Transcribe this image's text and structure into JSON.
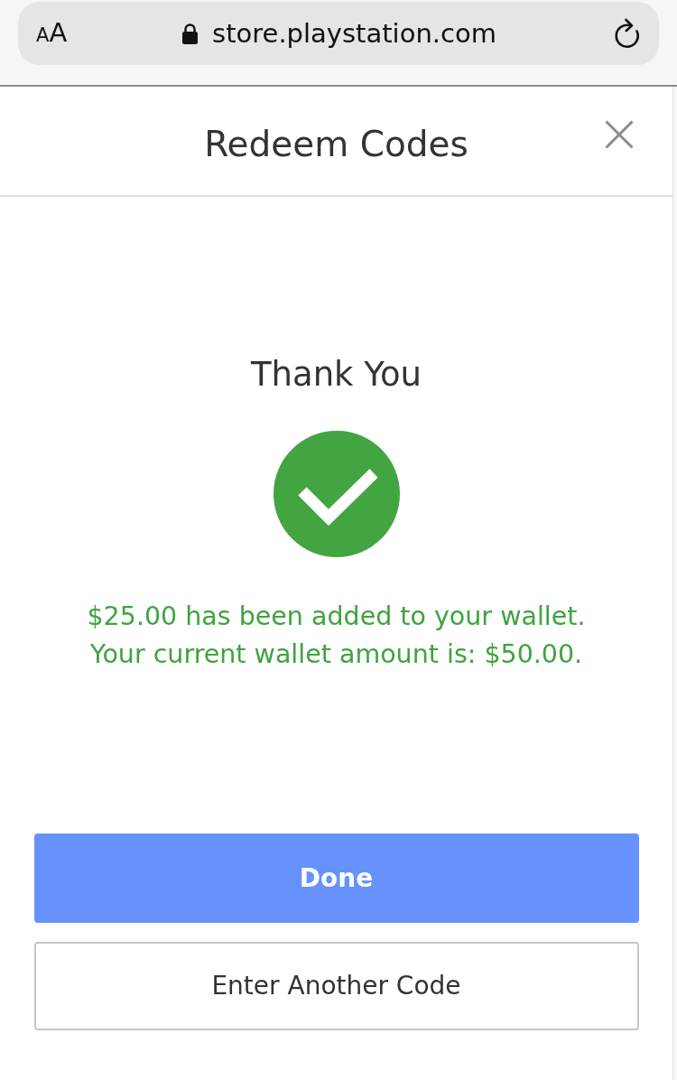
{
  "browser": {
    "text_size_button": "AA",
    "secure": true,
    "url": "store.playstation.com"
  },
  "dialog": {
    "title": "Redeem Codes"
  },
  "confirmation": {
    "heading": "Thank You",
    "message": [
      "$25.00 has been added to your wallet.",
      "Your current wallet amount is: $50.00."
    ]
  },
  "buttons": [
    {
      "label": "Done",
      "kind": "primary"
    },
    {
      "label": "Enter Another Code",
      "kind": "secondary"
    }
  ]
}
